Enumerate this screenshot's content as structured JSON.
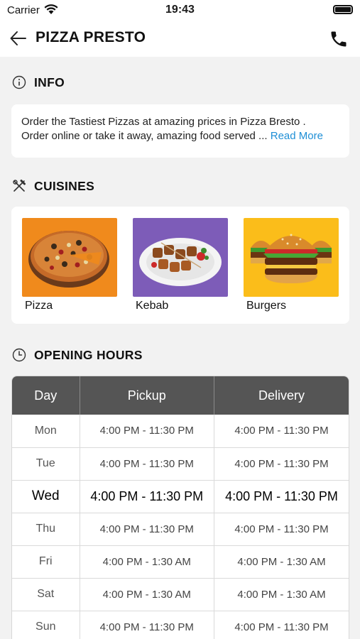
{
  "status_bar": {
    "carrier": "Carrier",
    "time": "19:43"
  },
  "header": {
    "title": "PIZZA PRESTO",
    "back_icon": "arrow-left-icon",
    "phone_icon": "phone-icon"
  },
  "info": {
    "heading": "INFO",
    "line1": "Order the Tastiest Pizzas at amazing prices in Pizza Bresto .",
    "line2": "Order online or take it away, amazing food served ... ",
    "read_more": "Read More"
  },
  "cuisines": {
    "heading": "CUISINES",
    "items": [
      {
        "label": "Pizza",
        "bg": "#f08a1c"
      },
      {
        "label": "Kebab",
        "bg": "#7d5cb8"
      },
      {
        "label": "Burgers",
        "bg": "#fbbd1a"
      }
    ]
  },
  "opening_hours": {
    "heading": "OPENING HOURS",
    "columns": [
      "Day",
      "Pickup",
      "Delivery"
    ],
    "rows": [
      {
        "day": "Mon",
        "pickup": "4:00 PM - 11:30 PM",
        "delivery": "4:00 PM - 11:30 PM"
      },
      {
        "day": "Tue",
        "pickup": "4:00 PM - 11:30 PM",
        "delivery": "4:00 PM - 11:30 PM"
      },
      {
        "day": "Wed",
        "pickup": "4:00 PM - 11:30 PM",
        "delivery": "4:00 PM - 11:30 PM"
      },
      {
        "day": "Thu",
        "pickup": "4:00 PM - 11:30 PM",
        "delivery": "4:00 PM - 11:30 PM"
      },
      {
        "day": "Fri",
        "pickup": "4:00 PM - 1:30 AM",
        "delivery": "4:00 PM - 1:30 AM"
      },
      {
        "day": "Sat",
        "pickup": "4:00 PM - 1:30 AM",
        "delivery": "4:00 PM - 1:30 AM"
      },
      {
        "day": "Sun",
        "pickup": "4:00 PM - 11:30 PM",
        "delivery": "4:00 PM - 11:30 PM"
      }
    ]
  }
}
